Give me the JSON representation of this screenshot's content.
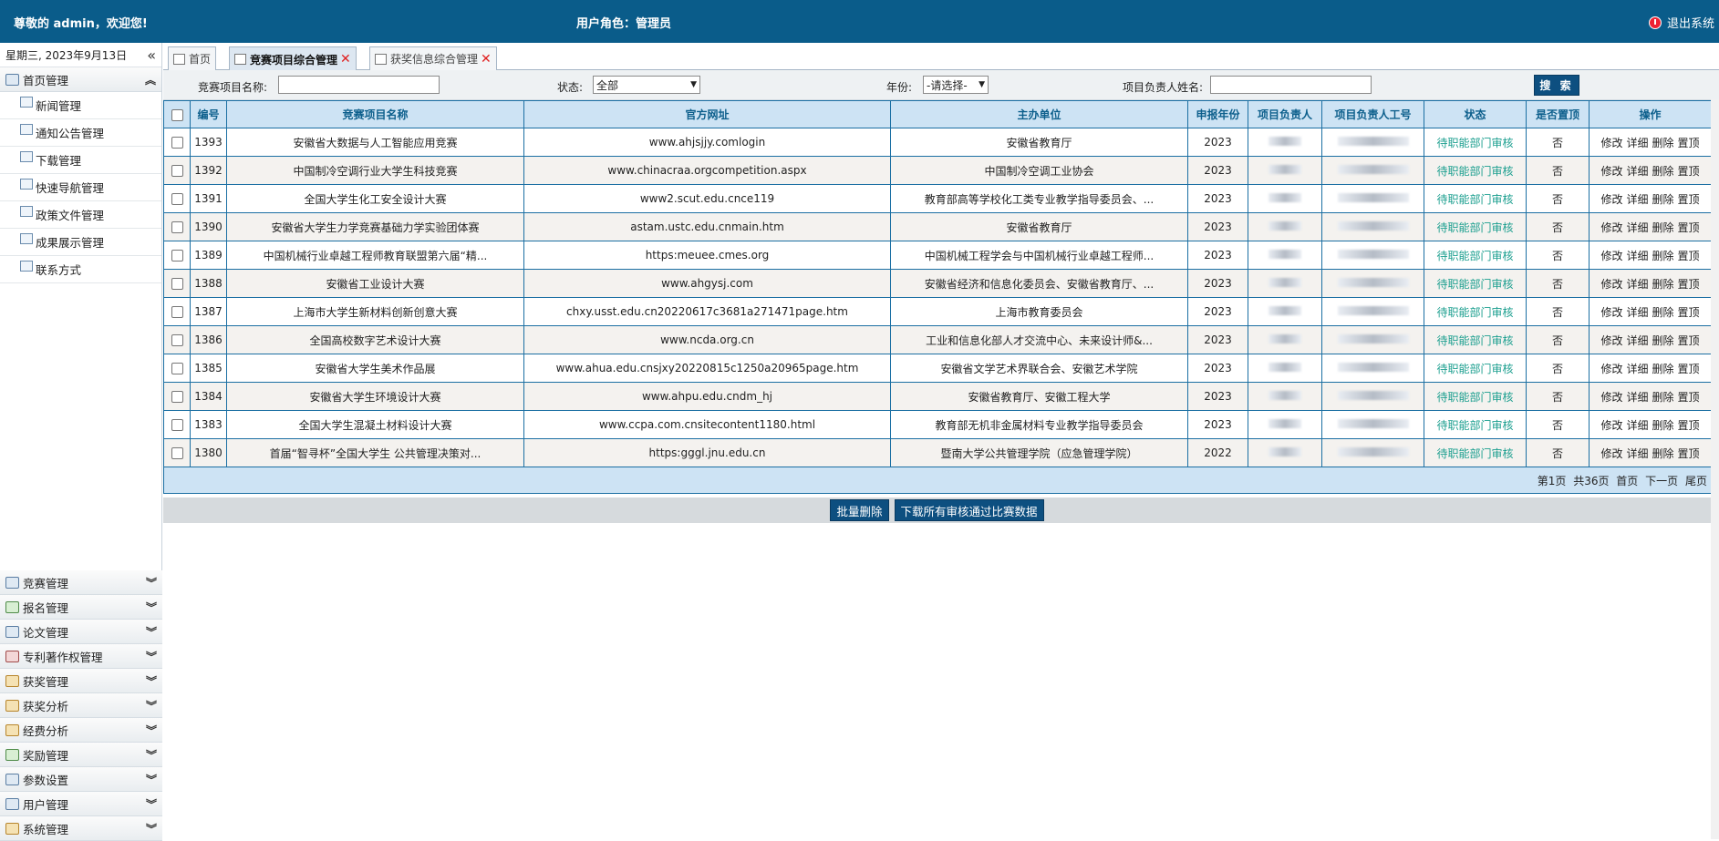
{
  "header": {
    "welcome": "尊敬的 admin，欢迎您!",
    "role": "用户角色：管理员",
    "logout": "退出系统"
  },
  "sidebar": {
    "date": "星期三, 2023年9月13日",
    "top_group": {
      "label": "首页管理",
      "items": [
        {
          "label": "新闻管理"
        },
        {
          "label": "通知公告管理"
        },
        {
          "label": "下载管理"
        },
        {
          "label": "快速导航管理"
        },
        {
          "label": "政策文件管理"
        },
        {
          "label": "成果展示管理"
        },
        {
          "label": "联系方式"
        }
      ]
    },
    "groups": [
      {
        "label": "竞赛管理"
      },
      {
        "label": "报名管理"
      },
      {
        "label": "论文管理"
      },
      {
        "label": "专利著作权管理"
      },
      {
        "label": "获奖管理"
      },
      {
        "label": "获奖分析"
      },
      {
        "label": "经费分析"
      },
      {
        "label": "奖励管理"
      },
      {
        "label": "参数设置"
      },
      {
        "label": "用户管理"
      },
      {
        "label": "系统管理"
      }
    ]
  },
  "tabs": [
    {
      "label": "首页"
    },
    {
      "label": "竞赛项目综合管理"
    },
    {
      "label": "获奖信息综合管理"
    }
  ],
  "search": {
    "name_label": "竞赛项目名称:",
    "status_label": "状态:",
    "status_value": "全部",
    "year_label": "年份:",
    "year_value": "-请选择-",
    "leader_label": "项目负责人姓名:",
    "button": "搜 索"
  },
  "table": {
    "headers": [
      "编号",
      "竞赛项目名称",
      "官方网址",
      "主办单位",
      "申报年份",
      "项目负责人",
      "项目负责人工号",
      "状态",
      "是否置顶",
      "操作"
    ],
    "rows": [
      {
        "id": "1393",
        "name": "安徽省大数据与人工智能应用竞赛",
        "url": "www.ahjsjjy.comlogin",
        "org": "安徽省教育厅",
        "year": "2023",
        "status": "待职能部门审核",
        "top": "否"
      },
      {
        "id": "1392",
        "name": "中国制冷空调行业大学生科技竞赛",
        "url": "www.chinacraa.orgcompetition.aspx",
        "org": "中国制冷空调工业协会",
        "year": "2023",
        "status": "待职能部门审核",
        "top": "否"
      },
      {
        "id": "1391",
        "name": "全国大学生化工安全设计大赛",
        "url": "www2.scut.edu.cnce119",
        "org": "教育部高等学校化工类专业教学指导委员会、...",
        "year": "2023",
        "status": "待职能部门审核",
        "top": "否"
      },
      {
        "id": "1390",
        "name": "安徽省大学生力学竞赛基础力学实验团体赛",
        "url": "astam.ustc.edu.cnmain.htm",
        "org": "安徽省教育厅",
        "year": "2023",
        "status": "待职能部门审核",
        "top": "否"
      },
      {
        "id": "1389",
        "name": "中国机械行业卓越工程师教育联盟第六届“精...",
        "url": "https:meuee.cmes.org",
        "org": "中国机械工程学会与中国机械行业卓越工程师...",
        "year": "2023",
        "status": "待职能部门审核",
        "top": "否"
      },
      {
        "id": "1388",
        "name": "安徽省工业设计大赛",
        "url": "www.ahgysj.com",
        "org": "安徽省经济和信息化委员会、安徽省教育厅、...",
        "year": "2023",
        "status": "待职能部门审核",
        "top": "否"
      },
      {
        "id": "1387",
        "name": "上海市大学生新材料创新创意大赛",
        "url": "chxy.usst.edu.cn20220617c3681a271471page.htm",
        "org": "上海市教育委员会",
        "year": "2023",
        "status": "待职能部门审核",
        "top": "否"
      },
      {
        "id": "1386",
        "name": "全国高校数字艺术设计大赛",
        "url": "www.ncda.org.cn",
        "org": "工业和信息化部人才交流中心、未来设计师&...",
        "year": "2023",
        "status": "待职能部门审核",
        "top": "否"
      },
      {
        "id": "1385",
        "name": "安徽省大学生美术作品展",
        "url": "www.ahua.edu.cnsjxy20220815c1250a20965page.htm",
        "org": "安徽省文学艺术界联合会、安徽艺术学院",
        "year": "2023",
        "status": "待职能部门审核",
        "top": "否"
      },
      {
        "id": "1384",
        "name": "安徽省大学生环境设计大赛",
        "url": "www.ahpu.edu.cndm_hj",
        "org": "安徽省教育厅、安徽工程大学",
        "year": "2023",
        "status": "待职能部门审核",
        "top": "否"
      },
      {
        "id": "1383",
        "name": "全国大学生混凝土材料设计大赛",
        "url": "www.ccpa.com.cnsitecontent1180.html",
        "org": "教育部无机非金属材料专业教学指导委员会",
        "year": "2023",
        "status": "待职能部门审核",
        "top": "否"
      },
      {
        "id": "1380",
        "name": "首届“智寻杯”全国大学生 公共管理决策对...",
        "url": "https:gggl.jnu.edu.cn",
        "org": "暨南大学公共管理学院（应急管理学院）",
        "year": "2022",
        "status": "待职能部门审核",
        "top": "否"
      }
    ],
    "ops": [
      "修改",
      "详细",
      "删除",
      "置顶"
    ]
  },
  "pager": {
    "current": "第1页",
    "total": "共36页",
    "first": "首页",
    "next": "下一页",
    "last": "尾页"
  },
  "actions": {
    "batch_delete": "批量删除",
    "download": "下载所有审核通过比赛数据"
  }
}
